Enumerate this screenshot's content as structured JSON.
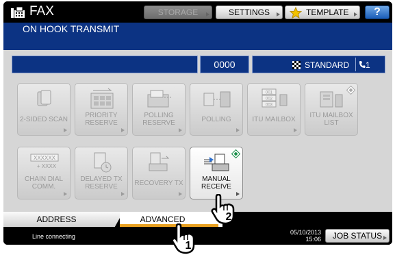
{
  "app": {
    "title": "FAX",
    "subtitle": "ON HOOK TRANSMIT"
  },
  "toolbar": {
    "storage_label": "STORAGE",
    "settings_label": "SETTINGS",
    "template_label": "TEMPLATE",
    "help_label": "?"
  },
  "info": {
    "count": "0000",
    "mode": "STANDARD",
    "line": "1"
  },
  "functions": [
    {
      "label": "2-SIDED SCAN",
      "enabled": false
    },
    {
      "label": "PRIORITY RESERVE",
      "enabled": false
    },
    {
      "label": "POLLING RESERVE",
      "enabled": false
    },
    {
      "label": "POLLING",
      "enabled": false
    },
    {
      "label": "ITU MAILBOX",
      "enabled": false
    },
    {
      "label": "ITU MAILBOX LIST",
      "enabled": false
    },
    {
      "label": "CHAIN DIAL COMM.",
      "enabled": false,
      "icon_text": "XXXXXX",
      "icon_subtext": "+ XXXX"
    },
    {
      "label": "DELAYED TX RESERVE",
      "enabled": false
    },
    {
      "label": "RECOVERY TX",
      "enabled": false
    },
    {
      "label": "MANUAL RECEIVE",
      "enabled": true
    }
  ],
  "mailbox_icon_codes": [
    "001",
    "002",
    "003"
  ],
  "tabs": [
    {
      "label": "ADDRESS",
      "active": false
    },
    {
      "label": "ADVANCED",
      "active": true
    }
  ],
  "statusbar": {
    "message": "Line connecting",
    "date": "05/10/2013",
    "time": "15:06",
    "job_status_label": "JOB STATUS"
  },
  "callouts": [
    "1",
    "2"
  ],
  "colors": {
    "header_blue": "#0c3383",
    "tab_accent": "#e8a020",
    "panel_gray": "#d6d6d6"
  }
}
